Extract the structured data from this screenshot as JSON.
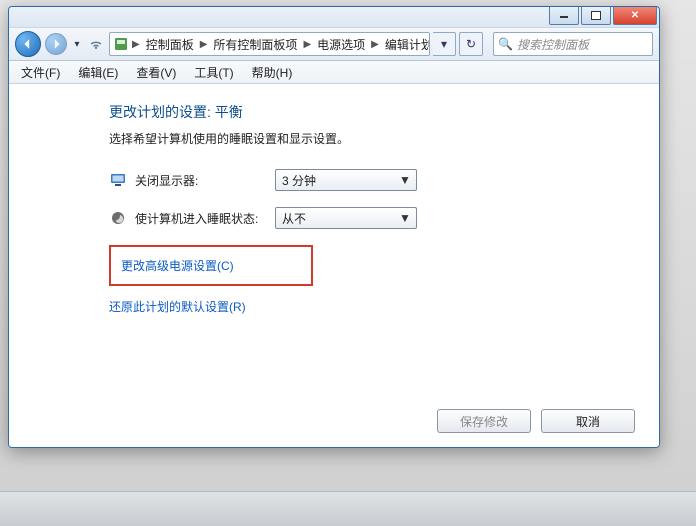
{
  "window_controls": {
    "min": "minimize",
    "max": "maximize",
    "close": "close"
  },
  "breadcrumb": {
    "root": "控制面板",
    "level1": "所有控制面板项",
    "level2": "电源选项",
    "level3": "编辑计划设置"
  },
  "search": {
    "placeholder": "搜索控制面板"
  },
  "menubar": {
    "file": "文件(F)",
    "edit": "编辑(E)",
    "view": "查看(V)",
    "tools": "工具(T)",
    "help": "帮助(H)"
  },
  "page": {
    "heading": "更改计划的设置: 平衡",
    "subtext": "选择希望计算机使用的睡眠设置和显示设置。",
    "row_display_off": {
      "label": "关闭显示器:",
      "value": "3 分钟"
    },
    "row_sleep": {
      "label": "使计算机进入睡眠状态:",
      "value": "从不"
    },
    "link_advanced": "更改高级电源设置(C)",
    "link_restore": "还原此计划的默认设置(R)",
    "btn_save": "保存修改",
    "btn_cancel": "取消"
  }
}
